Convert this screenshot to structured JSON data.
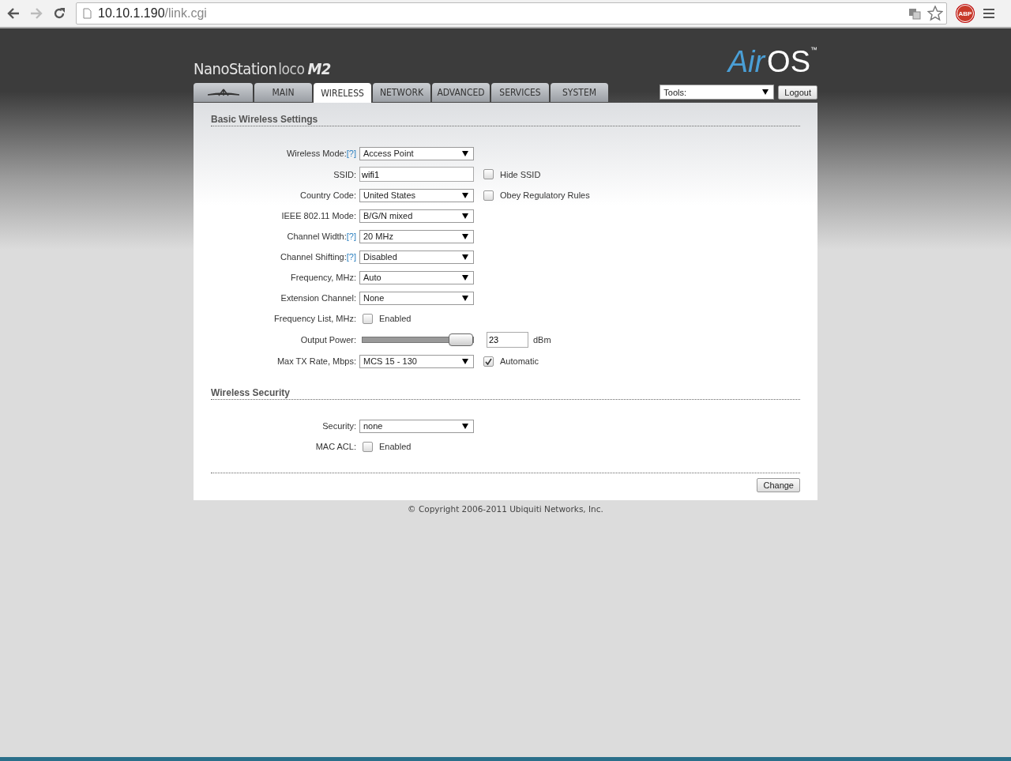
{
  "browser": {
    "host": "10.10.1.190",
    "path": "/link.cgi",
    "extension": "ABP"
  },
  "brand": {
    "product": "NanoStation",
    "model": "loco",
    "variant": "M2"
  },
  "os_logo": {
    "name": "Air",
    "suffix": "OS",
    "mark": "™"
  },
  "tabs": [
    {
      "kind": "icon",
      "selected": false
    },
    {
      "kind": "text",
      "label": "MAIN",
      "selected": false
    },
    {
      "kind": "text",
      "label": "WIRELESS",
      "selected": true
    },
    {
      "kind": "text",
      "label": "NETWORK",
      "selected": false
    },
    {
      "kind": "text",
      "label": "ADVANCED",
      "selected": false
    },
    {
      "kind": "text",
      "label": "SERVICES",
      "selected": false
    },
    {
      "kind": "text",
      "label": "SYSTEM",
      "selected": false
    }
  ],
  "tools": {
    "value": "Tools:"
  },
  "logout": "Logout",
  "sections": [
    {
      "title": "Basic Wireless Settings",
      "rows": [
        {
          "label": "Wireless Mode:",
          "help": "[?]",
          "kind": "select",
          "value": "Access Point"
        },
        {
          "label": "SSID:",
          "kind": "text",
          "value": "wifi1",
          "extra": {
            "label": "Hide SSID",
            "checked": false
          }
        },
        {
          "label": "Country Code:",
          "kind": "select",
          "value": "United States",
          "extra": {
            "label": "Obey Regulatory Rules",
            "checked": false
          }
        },
        {
          "label": "IEEE 802.11 Mode:",
          "kind": "select",
          "value": "B/G/N mixed"
        },
        {
          "label": "Channel Width:",
          "help": "[?]",
          "kind": "select",
          "value": "20 MHz"
        },
        {
          "label": "Channel Shifting:",
          "help": "[?]",
          "kind": "select",
          "value": "Disabled"
        },
        {
          "label": "Frequency, MHz:",
          "kind": "select",
          "value": "Auto"
        },
        {
          "label": "Extension Channel:",
          "kind": "select",
          "value": "None"
        },
        {
          "label": "Frequency List, MHz:",
          "kind": "checkbox",
          "text": "Enabled",
          "checked": false
        },
        {
          "label": "Output Power:",
          "kind": "slider",
          "level": 1,
          "value": "23",
          "unit": "dBm"
        },
        {
          "label": "Max TX Rate, Mbps:",
          "kind": "select",
          "value": "MCS 15 - 130",
          "extra": {
            "label": "Automatic",
            "checked": true
          }
        }
      ]
    },
    {
      "title": "Wireless Security",
      "rows": [
        {
          "label": "Security:",
          "kind": "select",
          "value": "none"
        },
        {
          "label": "MAC ACL:",
          "kind": "checkbox",
          "text": "Enabled",
          "checked": false
        }
      ]
    }
  ],
  "change_button": "Change",
  "copyright": "© Copyright 2006-2011 Ubiquiti Networks, Inc."
}
